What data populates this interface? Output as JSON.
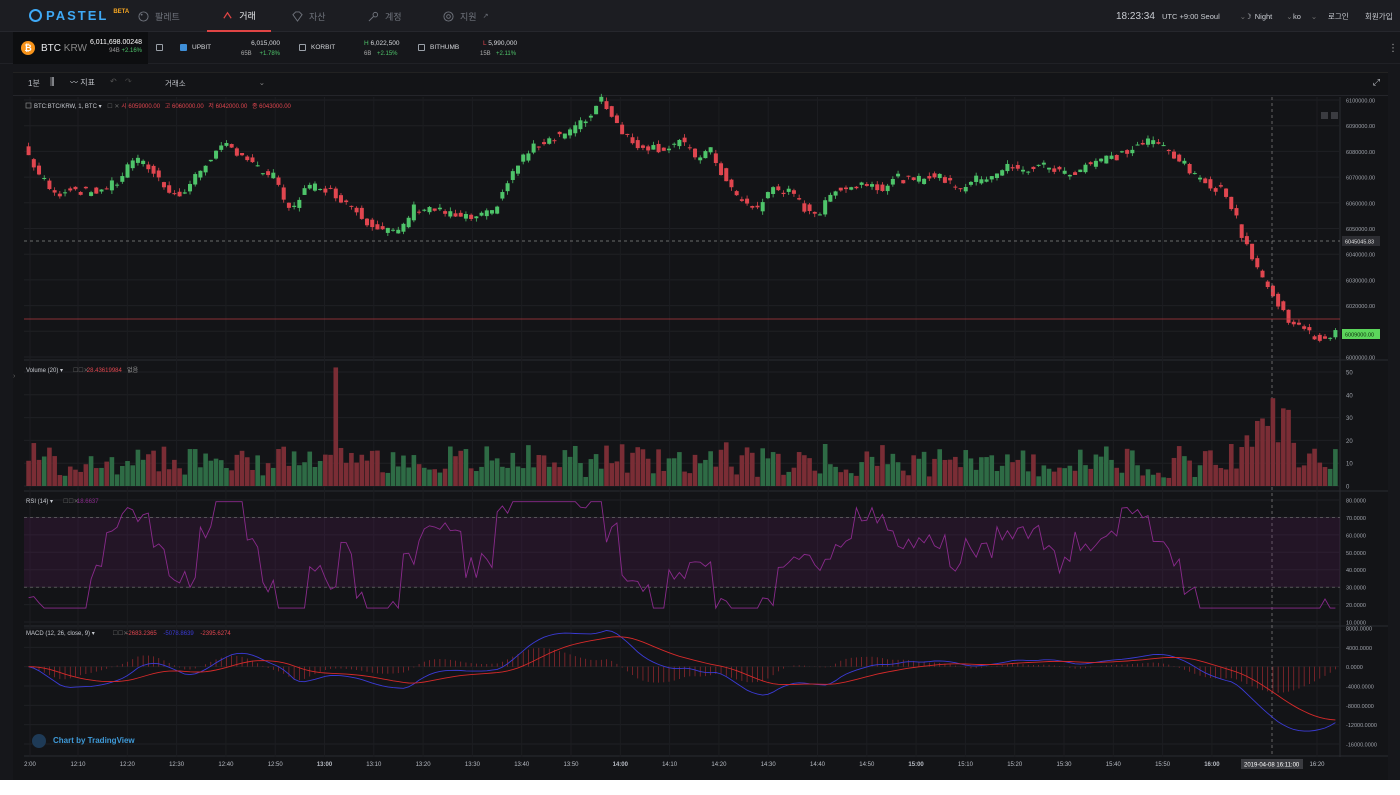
{
  "nav": {
    "logo": "PASTEL",
    "beta": "BETA",
    "items": [
      {
        "label": "팔레트",
        "icon": "palette-icon"
      },
      {
        "label": "거래",
        "icon": "trade-icon"
      },
      {
        "label": "자산",
        "icon": "diamond-icon"
      },
      {
        "label": "계정",
        "icon": "key-icon"
      },
      {
        "label": "지원",
        "icon": "support-icon"
      }
    ],
    "clock": "18:23:34",
    "timezone": "UTC +9:00 Seoul",
    "theme": "Night",
    "lang": "ko",
    "login": "로그인",
    "signup": "회원가입"
  },
  "ticker": {
    "symbol": "BTC",
    "quote": "KRW",
    "price": "6,011,698.00248",
    "vol": "94B",
    "change": "+2.16%",
    "exchanges": [
      {
        "name": "UPBIT",
        "checked": true,
        "price": "6,015,000",
        "vol": "65B",
        "change": "+1.78%"
      },
      {
        "name": "KORBIT",
        "checked": false,
        "price": "6,022,500",
        "vol": "6B",
        "change": "+2.15%",
        "prefix": "H"
      },
      {
        "name": "BITHUMB",
        "checked": false,
        "price": "5,990,000",
        "vol": "15B",
        "change": "+2.11%",
        "prefix": "L"
      }
    ]
  },
  "toolbar": {
    "interval": "1분",
    "indicators": "지표",
    "exchange": "거래소"
  },
  "main_legend": {
    "symbol": "BTC:BTC/KRW, 1, BTC",
    "o_label": "시",
    "o": "6059000.00",
    "h_label": "고",
    "h": "6060000.00",
    "l_label": "저",
    "l": "6042000.00",
    "c_label": "종",
    "c": "6043000.00"
  },
  "volume_legend": {
    "label": "Volume (20)",
    "value": "28.43619984",
    "extra": "없음"
  },
  "rsi_legend": {
    "label": "RSI (14)",
    "value": "18.6637"
  },
  "macd_legend": {
    "label": "MACD (12, 26, close, 9)",
    "v1": "-2683.2365",
    "v2": "-5078.8639",
    "v3": "-2395.6274"
  },
  "watermark": "Chart by TradingView",
  "cursor_time": "2019-04-08 16:11:00",
  "price_labels": {
    "crosshair": "6045045.83",
    "last": "6009000.00"
  },
  "colors": {
    "up": "#4ec46a",
    "down": "#e0464f",
    "accent": "#3fa9f5",
    "rsi": "#8a2a8c",
    "macd": "#3b3bd6",
    "signal": "#d62a2a"
  },
  "chart_data": [
    {
      "type": "candlestick",
      "title": "BTC:BTC/KRW, 1, BTC",
      "x_ticks": [
        "2:00",
        "12:10",
        "12:20",
        "12:30",
        "12:40",
        "12:50",
        "13:00",
        "13:10",
        "13:20",
        "13:30",
        "13:40",
        "13:50",
        "14:00",
        "14:10",
        "14:20",
        "14:30",
        "14:40",
        "14:50",
        "15:00",
        "15:10",
        "15:20",
        "15:30",
        "15:40",
        "15:50",
        "16:00",
        "16:20"
      ],
      "y_ticks": [
        "6100000.00",
        "6090000.00",
        "6080000.00",
        "6070000.00",
        "6060000.00",
        "6050000.00",
        "6040000.00",
        "6030000.00",
        "6020000.00",
        "6010000.00",
        "6000000.00"
      ],
      "ylim": [
        6000000,
        6100000
      ],
      "close": [
        6082000,
        6071000,
        6063000,
        6066000,
        6064000,
        6065000,
        6068000,
        6077000,
        6074000,
        6067000,
        6062000,
        6070000,
        6078000,
        6082000,
        6079000,
        6073000,
        6070000,
        6057000,
        6065000,
        6067000,
        6063000,
        6059000,
        6053000,
        6050000,
        6048000,
        6058000,
        6058000,
        6056000,
        6054000,
        6054000,
        6056000,
        6068000,
        6078000,
        6083000,
        6086000,
        6088000,
        6092000,
        6101000,
        6091000,
        6083000,
        6082000,
        6081000,
        6084000,
        6078000,
        6080000,
        6068000,
        6060000,
        6058000,
        6066000,
        6064000,
        6058000,
        6056000,
        6066000,
        6066000,
        6068000,
        6066000,
        6070000,
        6068000,
        6071000,
        6069000,
        6066000,
        6069000,
        6071000,
        6074000,
        6072000,
        6075000,
        6073000,
        6071000,
        6075000,
        6077000,
        6078000,
        6081000,
        6084000,
        6082000,
        6077000,
        6070000,
        6067000,
        6064000,
        6048000,
        6035000,
        6023000,
        6015000,
        6010000,
        6007000,
        6009000
      ],
      "note": "Intraday 1-minute BTC/KRW with sharp drop near 16:00"
    },
    {
      "type": "bar",
      "title": "Volume (20)",
      "y_ticks": [
        "50",
        "40",
        "30",
        "20",
        "10",
        "0"
      ],
      "ylim": [
        0,
        50
      ]
    },
    {
      "type": "line",
      "title": "RSI (14)",
      "y_ticks": [
        "80.0000",
        "70.0000",
        "60.0000",
        "50.0000",
        "40.0000",
        "30.0000",
        "20.0000",
        "10.0000"
      ],
      "ylim": [
        10,
        80
      ]
    },
    {
      "type": "line",
      "title": "MACD (12, 26, close, 9)",
      "y_ticks": [
        "8000.0000",
        "4000.0000",
        "0.0000",
        "-4000.0000",
        "-8000.0000",
        "-12000.0000",
        "-16000.0000"
      ],
      "ylim": [
        -18000,
        8000
      ]
    }
  ]
}
